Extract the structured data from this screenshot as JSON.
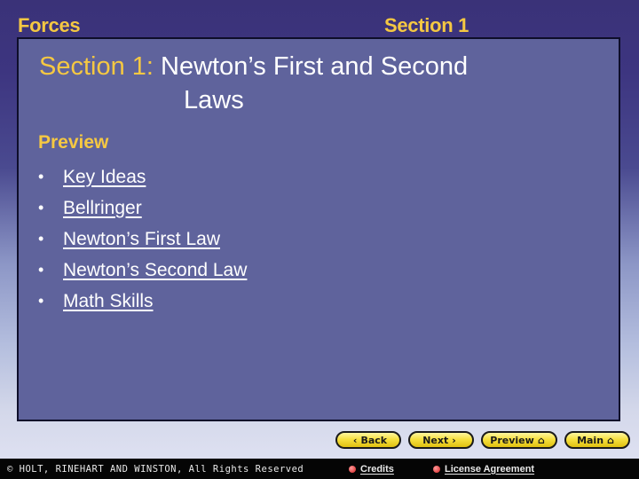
{
  "header": {
    "chapter": "Forces",
    "section": "Section 1"
  },
  "slide": {
    "title_prefix": "Section 1:",
    "title_line1": "Newton’s First and Second",
    "title_line2": "Laws",
    "preview_heading": "Preview",
    "bullet_glyph": "•",
    "items": [
      {
        "label": "Key Ideas"
      },
      {
        "label": "Bellringer"
      },
      {
        "label": "Newton’s First Law"
      },
      {
        "label": "Newton’s Second Law"
      },
      {
        "label": "Math Skills"
      }
    ]
  },
  "nav": {
    "back": {
      "label": "Back",
      "icon": "‹"
    },
    "next": {
      "label": "Next",
      "icon": "›"
    },
    "preview": {
      "label": "Preview",
      "icon": "⌂"
    },
    "main": {
      "label": "Main",
      "icon": "⌂"
    }
  },
  "footer": {
    "copyright": "© HOLT, RINEHART AND WINSTON, All Rights Reserved",
    "credits": "Credits",
    "license": "License Agreement"
  },
  "colors": {
    "accent_yellow": "#f5c842",
    "panel": "#5f639c",
    "background_top": "#3a3278"
  }
}
